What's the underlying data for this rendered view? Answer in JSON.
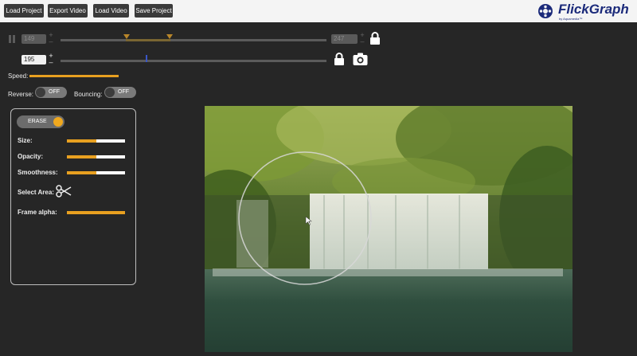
{
  "toolbar": {
    "load_project": "Load Project",
    "export_video": "Export Video",
    "load_video": "Load Video",
    "save_project": "Save Project"
  },
  "logo": {
    "name": "FlickGraph",
    "byline": "by Aquamedia™"
  },
  "timeline": {
    "start_frame": "149",
    "end_frame": "247",
    "current_frame": "195"
  },
  "controls": {
    "speed_label": "Speed:",
    "speed_fraction": 0.72,
    "reverse_label": "Reverse:",
    "reverse_state": "OFF",
    "bouncing_label": "Bouncing:",
    "bouncing_state": "OFF"
  },
  "erase_panel": {
    "mode_label": "ERASE",
    "size_label": "Size:",
    "size_fraction": 0.5,
    "opacity_label": "Opacity:",
    "opacity_fraction": 0.5,
    "smoothness_label": "Smoothness:",
    "smoothness_fraction": 0.5,
    "select_area_label": "Select Area:",
    "frame_alpha_label": "Frame alpha:",
    "frame_alpha_fraction": 1.0
  },
  "colors": {
    "accent": "#e8a020",
    "brand": "#1b2a7a",
    "background": "#262626"
  },
  "icons": [
    "pause-icon",
    "lock-icon",
    "camera-icon",
    "scissors-icon",
    "brush-cursor-icon"
  ]
}
